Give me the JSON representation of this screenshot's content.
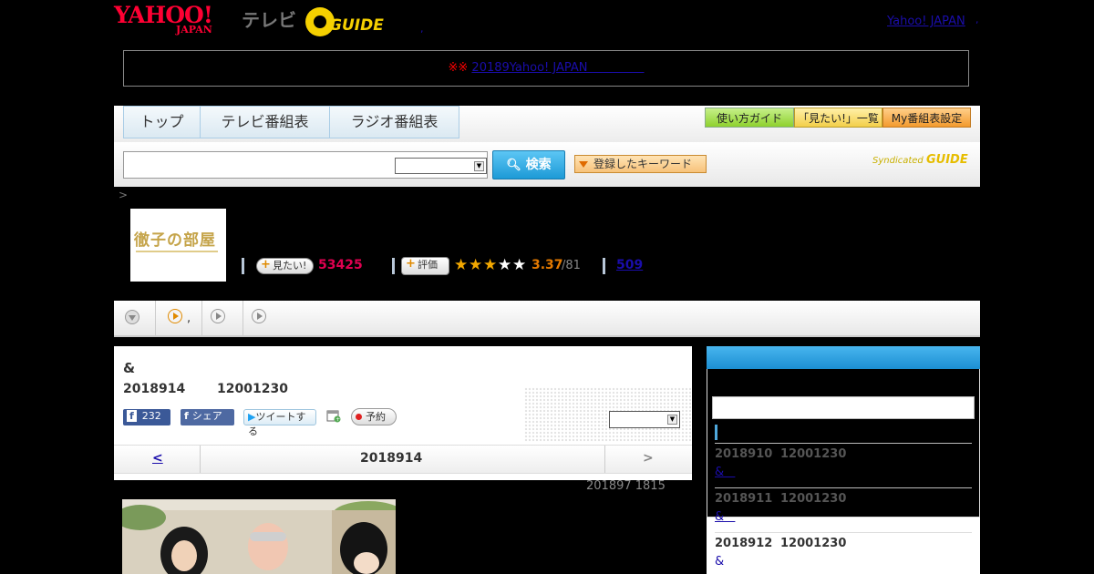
{
  "header": {
    "yahoo_logo": "YAHOO!",
    "yahoo_logo_sub": "JAPAN",
    "tv_label": "テレビ",
    "gguide_logo": "GUIDE",
    "dot": ",",
    "yahoo_japan_link": "Yahoo! JAPAN",
    "comma": ","
  },
  "notice": {
    "marks": "※※",
    "link_text": "20189Yahoo! JAPAN"
  },
  "nav": {
    "tabs": [
      "トップ",
      "テレビ番組表",
      "ラジオ番組表"
    ],
    "guide_button": "使い方ガイド",
    "mitai_list_button": "「見たい!」一覧",
    "my_settings_button": "My番組表設定"
  },
  "search": {
    "placeholder": "",
    "button": "検索",
    "keyword_button": "登録したキーワード",
    "syndicated": "Syndicated",
    "syndicated_brand": "GUIDE"
  },
  "breadcrumb": ">",
  "program": {
    "thumb_title": "徹子の部屋",
    "mitai_label": "見たい!",
    "mitai_count": "53425",
    "rating_label": "評価",
    "rating_stars": 3,
    "rating_max": 5,
    "rating_score": "3.37",
    "rating_total": "/81",
    "review_count": "509"
  },
  "subnav": {
    "item2_text": ","
  },
  "main": {
    "title": "&",
    "air_date": "2018914",
    "air_time": "12001230",
    "fb_count": "232",
    "fb_share": "シェア",
    "tweet": "ツイートする",
    "reserve": "予約",
    "pager_prev": "<",
    "pager_date": "2018914",
    "pager_next": ">",
    "updated": "201897  1815"
  },
  "sidebar": {
    "rows": [
      {
        "date": "2018910",
        "time": "12001230",
        "link": "&"
      },
      {
        "date": "2018911",
        "time": "12001230",
        "link": "&"
      },
      {
        "date": "2018912",
        "time": "12001230",
        "link": "&"
      }
    ]
  },
  "colors": {
    "accent_blue": "#1c9ad6",
    "brand_red": "#ff0033",
    "mitai_pink": "#e00050",
    "rating_orange": "#e57a00"
  }
}
